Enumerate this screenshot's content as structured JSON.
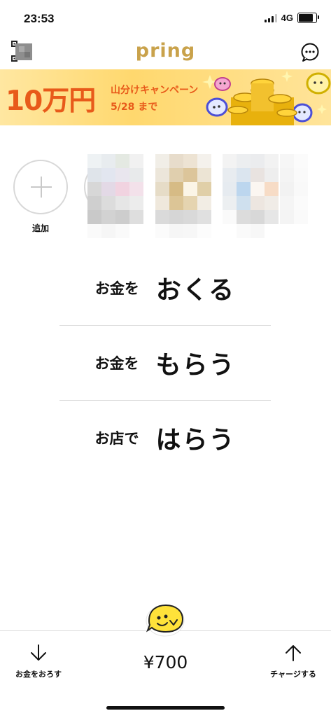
{
  "status_bar": {
    "time": "23:53",
    "network": "4G"
  },
  "header": {
    "logo": "pring",
    "qr_icon": "qr-code-icon",
    "chat_icon": "chat-bubble-icon"
  },
  "banner": {
    "big": "10万円",
    "line1": "山分けキャンペーン",
    "line2": "5/28 まで"
  },
  "friends": {
    "add_label": "追加"
  },
  "menu": {
    "items": [
      {
        "small": "お金を",
        "big": "おくる"
      },
      {
        "small": "お金を",
        "big": "もらう"
      },
      {
        "small": "お店で",
        "big": "はらう"
      }
    ]
  },
  "bottom": {
    "withdraw_label": "お金をおろす",
    "balance": "¥700",
    "charge_label": "チャージする"
  },
  "colors": {
    "brand_gold": "#c9a24b",
    "banner_orange": "#e85a1a",
    "banner_bg": "#ffd86e"
  }
}
